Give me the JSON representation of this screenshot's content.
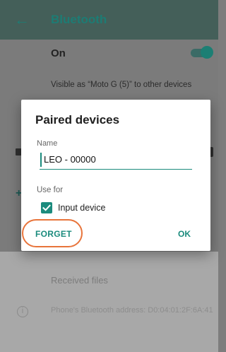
{
  "appbar": {
    "title": "Bluetooth",
    "back_icon": "arrow-back-icon"
  },
  "settings": {
    "on_label": "On",
    "visible_as": "Visible as “Moto G (5)” to other devices",
    "received_files": "Received files",
    "address": "Phone's Bluetooth address: D0:04:01:2F:6A:41"
  },
  "dialog": {
    "title": "Paired devices",
    "name_label": "Name",
    "name_value": "LEO - 00000",
    "use_for_label": "Use for",
    "input_device_label": "Input device",
    "input_device_checked": true,
    "forget_label": "FORGET",
    "ok_label": "OK"
  },
  "colors": {
    "accent": "#1b8b7d",
    "highlight_ring": "#e8743b"
  }
}
